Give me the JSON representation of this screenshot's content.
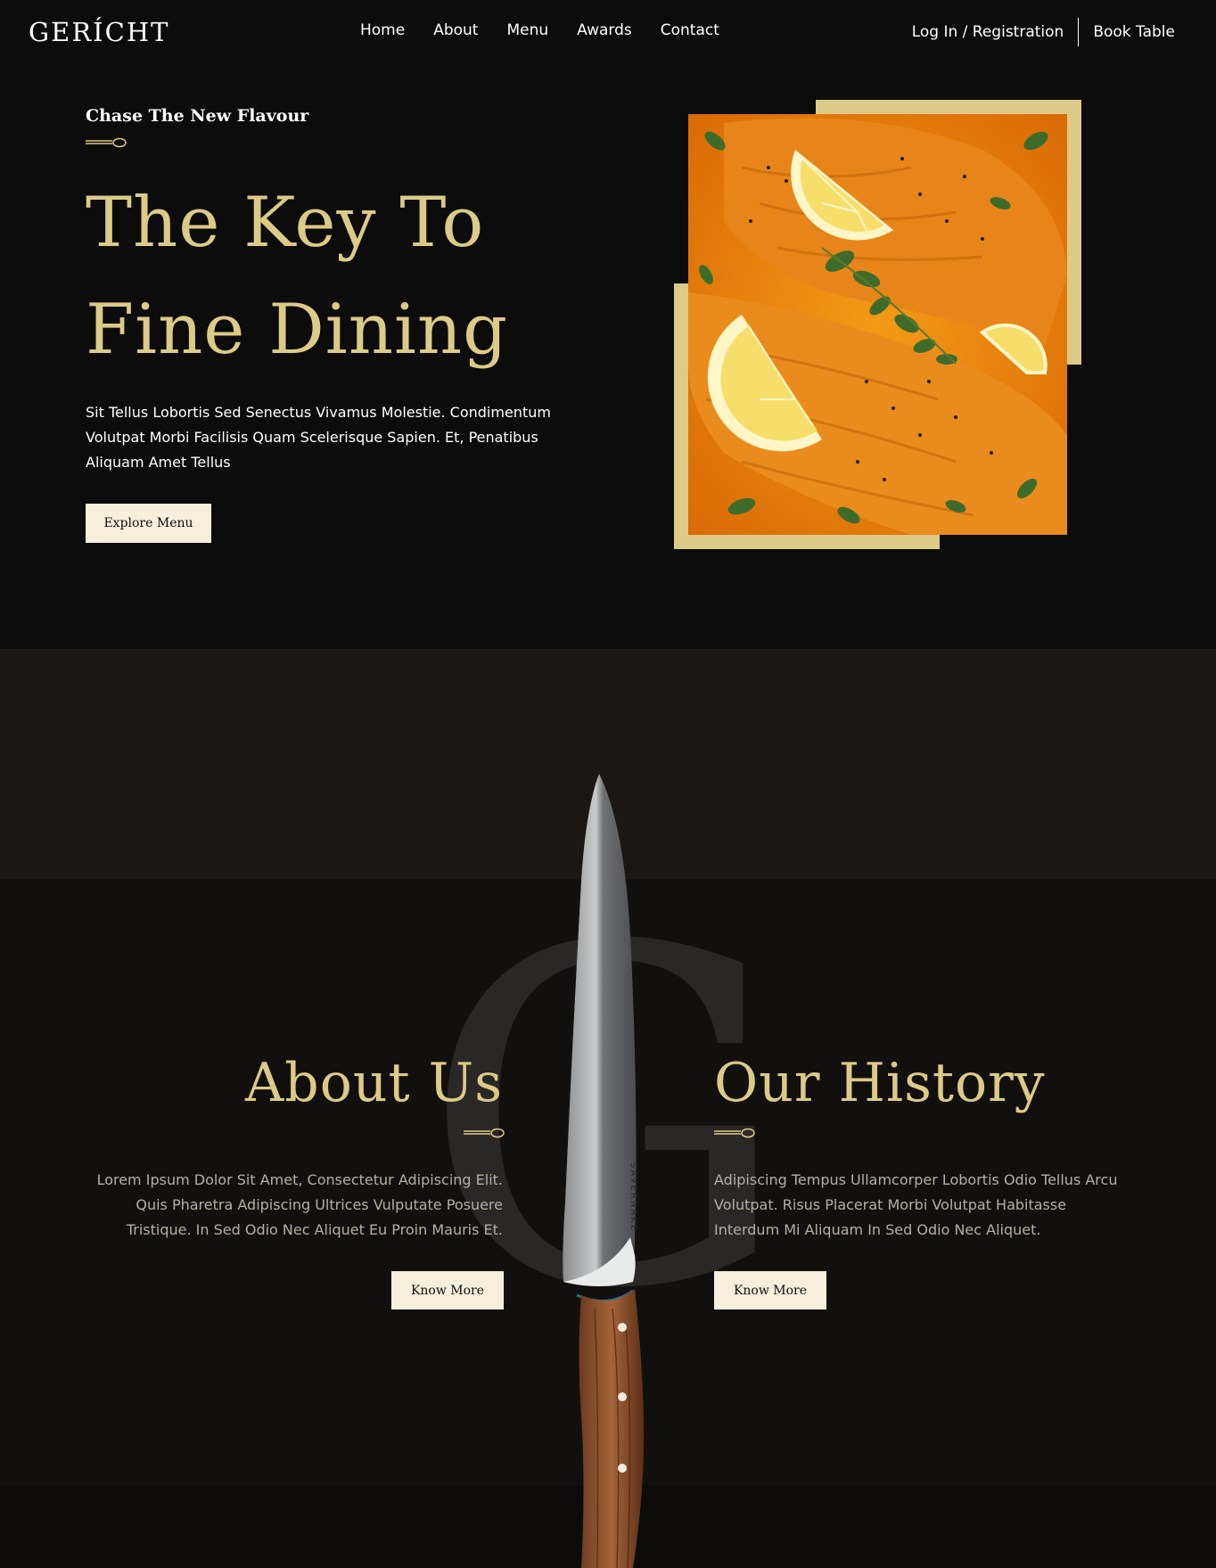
{
  "navbar": {
    "logo": "GERÍCHT",
    "links": [
      "Home",
      "About",
      "Menu",
      "Awards",
      "Contact"
    ],
    "login": "Log In / Registration",
    "book": "Book Table"
  },
  "hero": {
    "subtitle": "Chase The New Flavour",
    "title_line1": "The Key To",
    "title_line2": "Fine Dining",
    "description": "Sit Tellus Lobortis Sed Senectus Vivamus Molestie. Condimentum Volutpat Morbi Facilisis Quam Scelerisque Sapien. Et, Penatibus Aliquam Amet Tellus",
    "button": "Explore Menu"
  },
  "about": {
    "watermark": "G",
    "knife_brand": "SAVERNAKE",
    "about_title": "About Us",
    "about_text": "Lorem Ipsum Dolor Sit Amet, Consectetur Adipiscing Elit. Quis Pharetra Adipiscing Ultrices Vulputate Posuere Tristique. In Sed Odio Nec Aliquet Eu Proin Mauris Et.",
    "about_button": "Know More",
    "history_title": "Our History",
    "history_text": "Adipiscing Tempus Ullamcorper Lobortis Odio Tellus Arcu Volutpat. Risus Placerat Morbi Volutpat Habitasse Interdum Mi Aliquam In Sed Odio Nec Aliquet.",
    "history_button": "Know More"
  },
  "colors": {
    "gold": "#dcca87",
    "black": "#0c0c0c",
    "crimson_white": "#f5efdb"
  }
}
